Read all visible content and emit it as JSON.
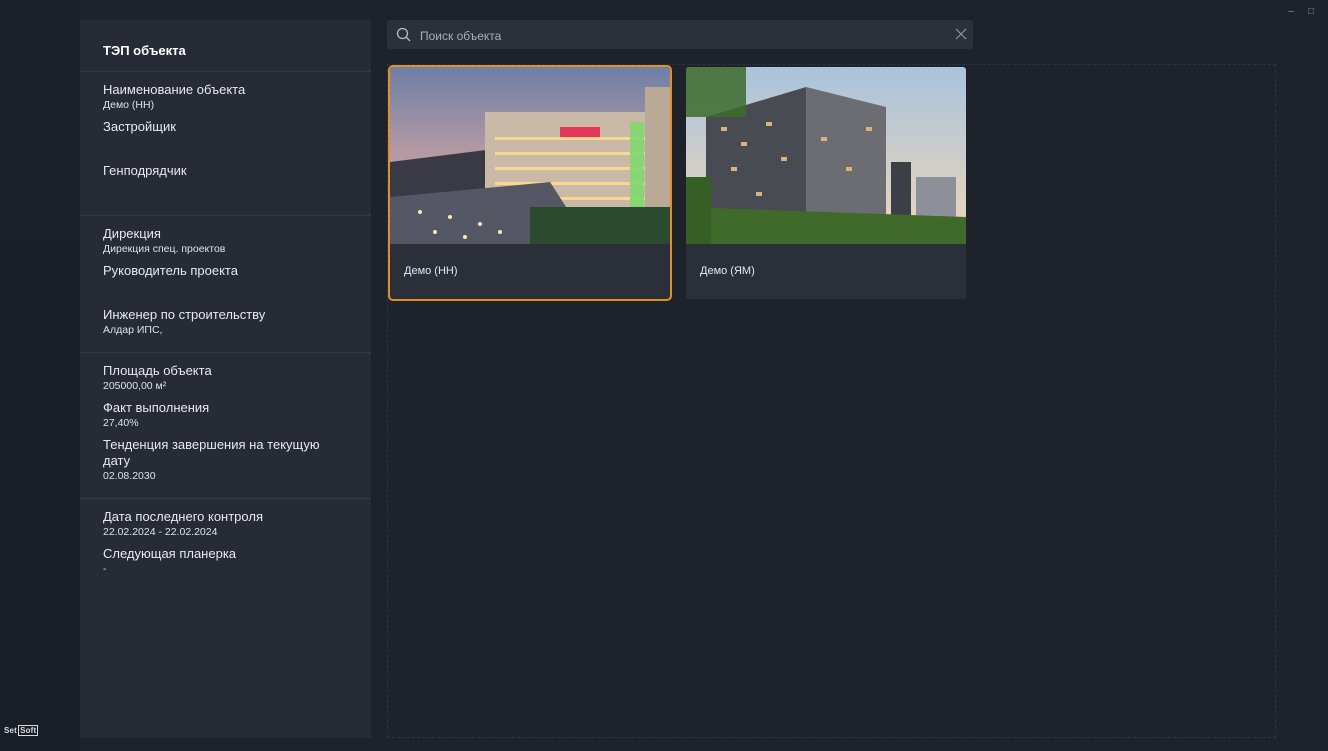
{
  "window": {
    "minimize": "–",
    "maximize": "□"
  },
  "logo": {
    "part1": "Set",
    "part2": "Soft"
  },
  "panel": {
    "title": "ТЭП объекта",
    "fields": {
      "name": {
        "label": "Наименование объекта",
        "value": "Демо (НН)"
      },
      "developer": {
        "label": "Застройщик",
        "value": ""
      },
      "general_contractor": {
        "label": "Генподрядчик",
        "value": ""
      },
      "directorate": {
        "label": "Дирекция",
        "value": "Дирекция спец. проектов"
      },
      "project_manager": {
        "label": "Руководитель проекта",
        "value": ""
      },
      "construction_engineer": {
        "label": "Инженер по строительству",
        "value": "Алдар ИПС,"
      },
      "area": {
        "label": "Площадь объекта",
        "value": "205000,00 м²"
      },
      "progress": {
        "label": "Факт выполнения",
        "value": "27,40%"
      },
      "completion_trend": {
        "label": "Тенденция завершения на текущую дату",
        "value": "02.08.2030"
      },
      "last_control": {
        "label": "Дата последнего контроля",
        "value": "22.02.2024 - 22.02.2024"
      },
      "next_meeting": {
        "label": "Следующая планерка",
        "value": "-"
      }
    }
  },
  "search": {
    "placeholder": "Поиск объекта",
    "value": ""
  },
  "objects": [
    {
      "name": "Демо (НН)",
      "selected": true
    },
    {
      "name": "Демо (ЯМ)",
      "selected": false
    }
  ],
  "colors": {
    "accent": "#e0902a",
    "panel": "#262b35",
    "background": "#1e222b"
  }
}
